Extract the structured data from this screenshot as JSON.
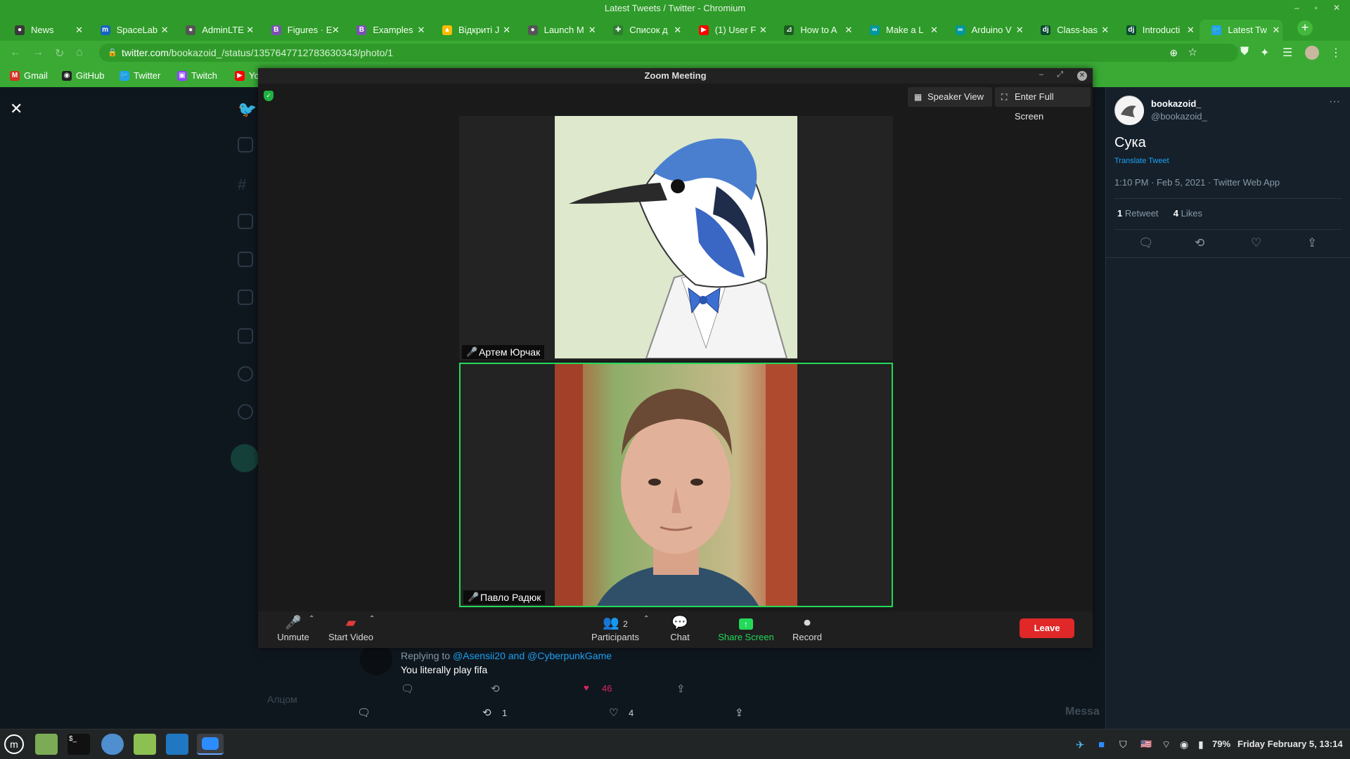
{
  "window": {
    "title": "Latest Tweets / Twitter - Chromium"
  },
  "tabs": [
    {
      "label": "News",
      "icon": "circle-icon",
      "color": "#3a3a3a"
    },
    {
      "label": "SpaceLab",
      "icon": "m-icon",
      "color": "#1565c0"
    },
    {
      "label": "AdminLTE",
      "icon": "circle-icon",
      "color": "#555555"
    },
    {
      "label": "Figures · E",
      "icon": "b-icon",
      "color": "#7952b3"
    },
    {
      "label": "Examples",
      "icon": "b-icon",
      "color": "#7952b3"
    },
    {
      "label": "Відкриті J",
      "icon": "drive-icon",
      "color": "#fbbc04"
    },
    {
      "label": "Launch M",
      "icon": "circle-icon",
      "color": "#555555"
    },
    {
      "label": "Список д",
      "icon": "cross-icon",
      "color": "#2e7d32"
    },
    {
      "label": "(1) User F",
      "icon": "youtube-icon",
      "color": "#ff0000"
    },
    {
      "label": "How to A",
      "icon": "chart-icon",
      "color": "#1b5e20"
    },
    {
      "label": "Make a L",
      "icon": "arduino-icon",
      "color": "#00979d"
    },
    {
      "label": "Arduino V",
      "icon": "arduino-icon",
      "color": "#00979d"
    },
    {
      "label": "Class-bas",
      "icon": "django-icon",
      "color": "#0c4b33"
    },
    {
      "label": "Introducti",
      "icon": "django-icon",
      "color": "#0c4b33"
    },
    {
      "label": "Latest Tw",
      "icon": "twitter-icon",
      "color": "#1da1f2"
    }
  ],
  "address": {
    "host": "twitter.com",
    "path": "/bookazoid_/status/1357647712783630343/photo/1"
  },
  "bookmarks": [
    {
      "label": "Gmail",
      "icon": "gmail-icon",
      "color": "#d93025"
    },
    {
      "label": "GitHub",
      "icon": "github-icon",
      "color": "#222222"
    },
    {
      "label": "Twitter",
      "icon": "twitter-icon",
      "color": "#1da1f2"
    },
    {
      "label": "Twitch",
      "icon": "twitch-icon",
      "color": "#9146ff"
    },
    {
      "label": "Yo",
      "icon": "youtube-icon",
      "color": "#ff0000"
    }
  ],
  "tweet": {
    "name": "bookazoid_",
    "handle": "@bookazoid_",
    "text": "Сука",
    "translate": "Translate Tweet",
    "meta": "1:10 PM · Feb 5, 2021 · Twitter Web App",
    "retweets_count": "1",
    "retweets_label": " Retweet",
    "likes_count": "4",
    "likes_label": " Likes"
  },
  "reply": {
    "prefix": "Replying to ",
    "mention1": "@Asensii20",
    "joiner": " and ",
    "mention2": "@CyberpunkGame",
    "text": "You literally play fifa",
    "likes": "46"
  },
  "photo_actions": {
    "retweets": "1",
    "likes": "4"
  },
  "background_user": {
    "name": "Алцом"
  },
  "message_hint": "Messa",
  "zoom": {
    "title": "Zoom Meeting",
    "speaker_view": "Speaker View",
    "full_screen": "Enter Full Screen",
    "participants": [
      {
        "name": "Артем Юрчак",
        "muted": true
      },
      {
        "name": "Павло Радюк",
        "muted": true,
        "active_speaker": true
      }
    ],
    "toolbar": {
      "unmute": "Unmute",
      "start_video": "Start Video",
      "participants_label": "Participants",
      "participants_count": "2",
      "chat": "Chat",
      "share": "Share Screen",
      "record": "Record",
      "leave": "Leave"
    },
    "colors": {
      "active_border": "#23d959",
      "leave": "#e02828"
    }
  },
  "taskbar": {
    "battery": "79%",
    "clock": "Friday February  5, 13:14"
  },
  "colors": {
    "chrome": "#3aaa35",
    "twitter_bg": "#15202b",
    "accent": "#1da1f2"
  }
}
